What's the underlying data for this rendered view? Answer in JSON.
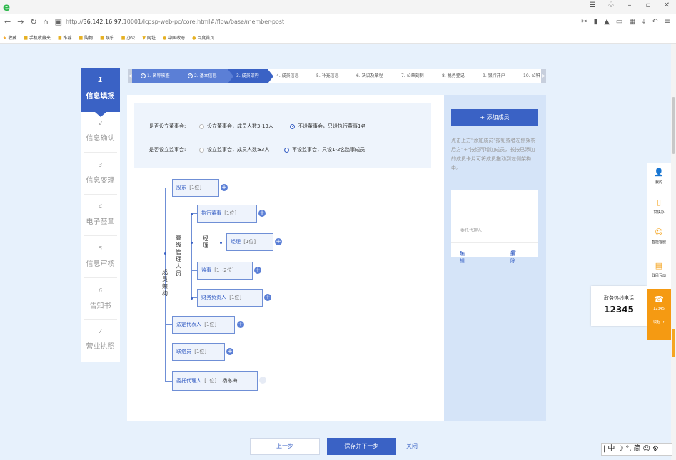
{
  "browser": {
    "url_prefix": "http://",
    "url_host": "36.142.16.97",
    "url_rest": ":10001/lcpsp-web-pc/core.html#/flow/base/member-post",
    "bookmarks": [
      "收藏",
      "手机收藏夹",
      "推荐",
      "购物",
      "娱乐",
      "办公",
      "网址",
      "中国政府",
      "百度首页"
    ]
  },
  "steps": [
    {
      "num": "1",
      "label": "信息填报",
      "active": true
    },
    {
      "num": "2",
      "label": "信息确认"
    },
    {
      "num": "3",
      "label": "信息变理"
    },
    {
      "num": "4",
      "label": "电子签章"
    },
    {
      "num": "5",
      "label": "信息审核"
    },
    {
      "num": "6",
      "label": "告知书"
    },
    {
      "num": "7",
      "label": "营业执照"
    }
  ],
  "flow_tabs": [
    {
      "label": "1. 名称核查",
      "state": "done"
    },
    {
      "label": "2. 基本信息",
      "state": "done"
    },
    {
      "label": "3. 成员架构",
      "state": "cur"
    },
    {
      "label": "4. 成员信息"
    },
    {
      "label": "5. 补充信息"
    },
    {
      "label": "6. 决议及章程"
    },
    {
      "label": "7. 公章刻制"
    },
    {
      "label": "8. 税务登记"
    },
    {
      "label": "9. 银行开户"
    },
    {
      "label": "10. 公积"
    }
  ],
  "options": {
    "board_label": "是否设立董事会:",
    "board_opt1": "设立董事会，成员人数3-13人",
    "board_opt2": "不设董事会，只设执行董事1名",
    "supervisor_label": "是否设立监事会:",
    "supervisor_opt1": "设立监事会，成员人数≥3人",
    "supervisor_opt2": "不设监事会，只设1-2名监事成员"
  },
  "tree": {
    "root_label": "成员架构",
    "mgmt_label": "高级管理人员",
    "mgr_group_label": "经理",
    "nodes": {
      "shareholder": {
        "name": "股东",
        "count": "[1位]"
      },
      "exec_director": {
        "name": "执行董事",
        "count": "[1位]"
      },
      "manager": {
        "name": "经理",
        "count": "[1位]"
      },
      "supervisor": {
        "name": "监事",
        "count": "[1~2位]"
      },
      "finance": {
        "name": "财务负责人",
        "count": "[1位]"
      },
      "legal_rep": {
        "name": "法定代表人",
        "count": "[1位]"
      },
      "liaison": {
        "name": "联络员",
        "count": "[1位]"
      },
      "agent": {
        "name": "委托代理人",
        "count": "[1位]",
        "person": "杨冬梅"
      }
    }
  },
  "right_panel": {
    "add_button": "+ 添加成员",
    "hint": "点击上方\"添加成员\"按钮或者左侧架构后方\"+\"按钮可增加成员，长按已添加的成员卡片可将成员拖动到左侧架构中。",
    "card_role": "委托代理人",
    "edit": "编辑",
    "delete": "删除"
  },
  "buttons": {
    "prev": "上一步",
    "next": "保存并下一步",
    "close": "关闭"
  },
  "service": {
    "mine": "我的",
    "paper": "甘快办",
    "assistant": "智能客服",
    "interact": "政民互动",
    "hotline_short": "12345",
    "collapse": "收起",
    "hotline_title": "政务热线电话",
    "hotline_number": "12345"
  },
  "ime": [
    "中",
    "简"
  ]
}
